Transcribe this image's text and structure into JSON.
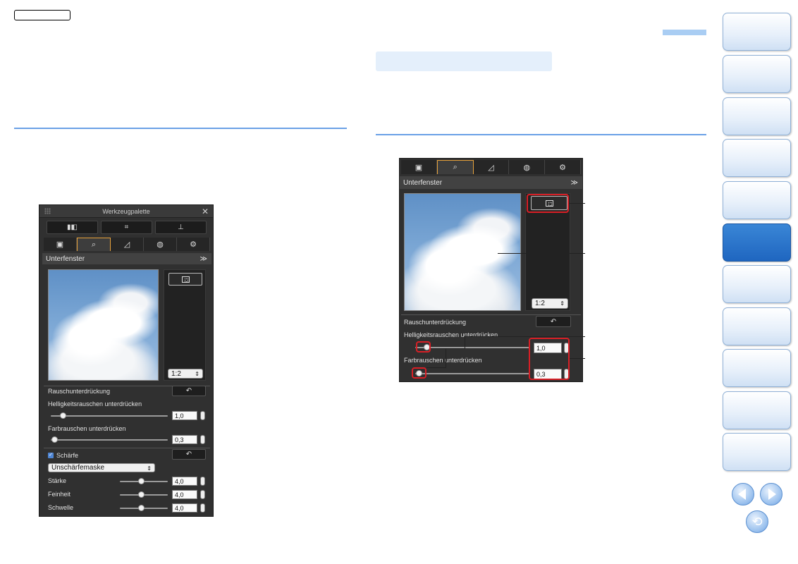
{
  "left_palette": {
    "title": "Werkzeugpalette",
    "close_glyph": "✕",
    "section_title": "Unterfenster",
    "zoom": "1:2",
    "noise_section": "Rauschunterdrückung",
    "luminance_label": "Helligkeitsrauschen unterdrücken",
    "luminance_value": "1,0",
    "luminance_level": 0.1,
    "chroma_label": "Farbrauschen unterdrücken",
    "chroma_value": "0,3",
    "chroma_level": 0.03,
    "sharpness_label": "Schärfe",
    "sharpness_mode": "Unschärfemaske",
    "strength_label": "Stärke",
    "strength_value": "4,0",
    "fineness_label": "Feinheit",
    "fineness_value": "4,0",
    "threshold_label": "Schwelle",
    "threshold_value": "4,0"
  },
  "right_palette": {
    "section_title": "Unterfenster",
    "zoom": "1:2",
    "noise_section": "Rauschunterdrückung",
    "luminance_label": "Helligkeitsrauschen unterdrücken",
    "luminance_value": "1,0",
    "chroma_label": "Farbrauschen unterdrücken",
    "chroma_value": "0,3"
  },
  "icons": {
    "top_buttons": [
      "filmstrip-icon",
      "crop-icon",
      "stamp-icon"
    ],
    "tabs": [
      "basic-adjust-icon",
      "noise-sharpness-icon",
      "tone-curve-icon",
      "color-icon",
      "settings-icon"
    ],
    "tab_glyphs": [
      "▣",
      "⌕",
      "◿",
      "◍",
      "⚙"
    ],
    "top_glyphs": [
      "▮◧",
      "⌗",
      "⊥"
    ],
    "reset_glyph": "↶",
    "collapse_glyph": "≫",
    "check_glyph": "✓",
    "spin_glyph": "⇕",
    "nav_prev": "arrow-left-icon",
    "nav_next": "arrow-right-icon",
    "nav_back": "return-icon",
    "back_glyph": "⟲"
  },
  "colors": {
    "accent_blue": "#6aa0e6",
    "active_nav": "#1f66c0",
    "highlight_red": "#d81f26"
  },
  "nav_tabs": {
    "count": 11,
    "active_index": 5
  }
}
